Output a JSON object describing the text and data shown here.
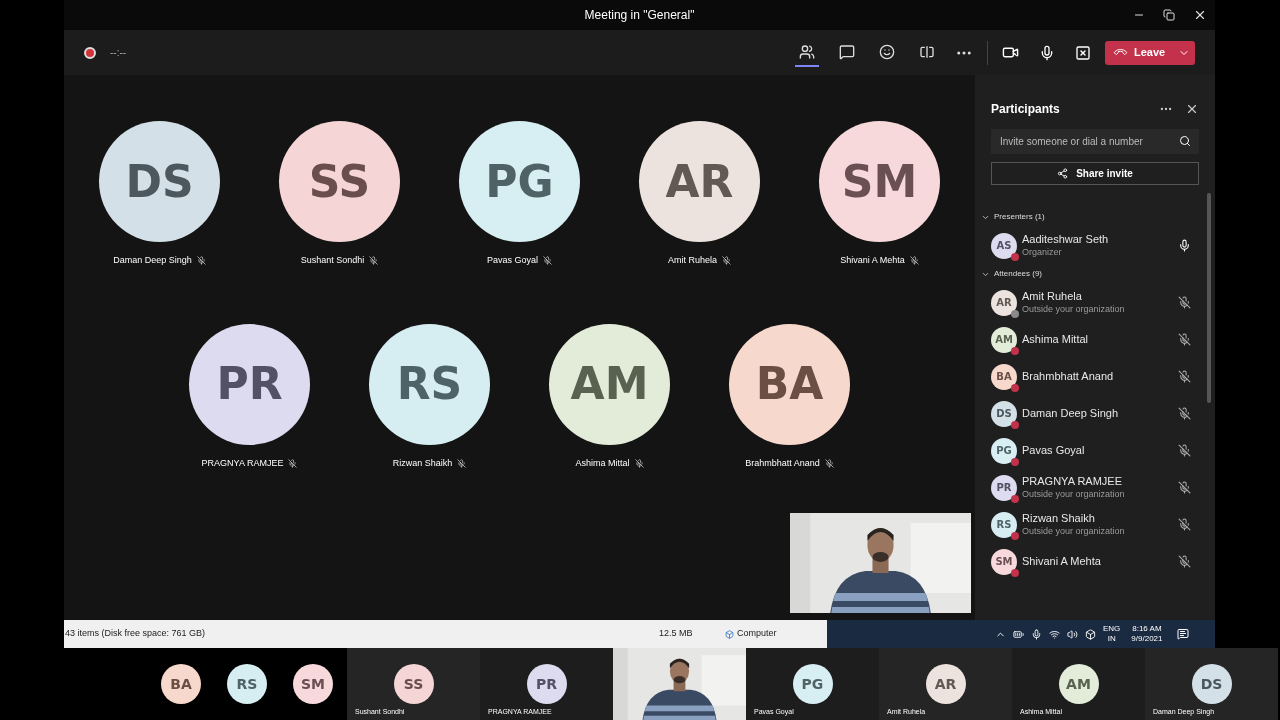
{
  "window": {
    "title": "Meeting in \"General\""
  },
  "toolbar": {
    "timer": "--:--",
    "leave": "Leave",
    "tabs": [
      {
        "kind": "people",
        "selected": true
      },
      {
        "kind": "chat",
        "selected": false
      },
      {
        "kind": "reactions",
        "selected": false
      },
      {
        "kind": "rooms",
        "selected": false
      }
    ]
  },
  "stage": {
    "rows": [
      [
        {
          "initials": "DS",
          "name": "Daman Deep Singh",
          "color": "#d4e0e8"
        },
        {
          "initials": "SS",
          "name": "Sushant Sondhi",
          "color": "#f5d5d5"
        },
        {
          "initials": "PG",
          "name": "Pavas Goyal",
          "color": "#d7eef2"
        },
        {
          "initials": "AR",
          "name": "Amit Ruhela",
          "color": "#ede3de"
        },
        {
          "initials": "SM",
          "name": "Shivani A Mehta",
          "color": "#f7d9dc"
        }
      ],
      [
        {
          "initials": "PR",
          "name": "PRAGNYA RAMJEE",
          "color": "#dcdbef"
        },
        {
          "initials": "RS",
          "name": "Rizwan Shaikh",
          "color": "#d6eef2"
        },
        {
          "initials": "AM",
          "name": "Ashima Mittal",
          "color": "#e3ecd9"
        },
        {
          "initials": "BA",
          "name": "Brahmbhatt Anand",
          "color": "#f7d8cc"
        }
      ]
    ]
  },
  "participants": {
    "title": "Participants",
    "search": {
      "placeholder": "Invite someone or dial a number"
    },
    "share": "Share invite",
    "sections": [
      {
        "label": "Presenters (1)",
        "expanded": true,
        "people": [
          {
            "initials": "AS",
            "name": "Aaditeshwar Seth",
            "subtitle": "Organizer",
            "color": "#dcdbef",
            "status": {
              "color": "#c4314b"
            },
            "muted": false
          }
        ]
      },
      {
        "label": "Attendees (9)",
        "expanded": true,
        "people": [
          {
            "initials": "AR",
            "name": "Amit Ruhela",
            "subtitle": "Outside your organization",
            "color": "#ede3de",
            "status": {
              "color": "#8a8a8a"
            },
            "muted": true
          },
          {
            "initials": "AM",
            "name": "Ashima Mittal",
            "color": "#e3ecd9",
            "status": {
              "color": "#c4314b"
            },
            "muted": true
          },
          {
            "initials": "BA",
            "name": "Brahmbhatt Anand",
            "color": "#f7d8cc",
            "status": {
              "color": "#c4314b"
            },
            "muted": true
          },
          {
            "initials": "DS",
            "name": "Daman Deep Singh",
            "color": "#d4e0e8",
            "status": {
              "color": "#c4314b"
            },
            "muted": true
          },
          {
            "initials": "PG",
            "name": "Pavas Goyal",
            "color": "#d7eef2",
            "status": {
              "color": "#c4314b"
            },
            "muted": true
          },
          {
            "initials": "PR",
            "name": "PRAGNYA RAMJEE",
            "subtitle": "Outside your organization",
            "color": "#dcdbef",
            "status": {
              "color": "#c4314b"
            },
            "muted": true
          },
          {
            "initials": "RS",
            "name": "Rizwan Shaikh",
            "subtitle": "Outside your organization",
            "color": "#d6eef2",
            "status": {
              "color": "#c4314b"
            },
            "muted": true
          },
          {
            "initials": "SM",
            "name": "Shivani A Mehta",
            "color": "#f7d9dc",
            "status": {
              "color": "#c4314b"
            },
            "muted": true
          }
        ]
      }
    ]
  },
  "explorer_status": {
    "items": "43 items (Disk free space: 761 GB)",
    "size": "12.5 MB",
    "location": "Computer"
  },
  "taskbar": {
    "language": "ENG",
    "region": "IN",
    "time": "8:16 AM",
    "date": "9/9/2021"
  },
  "filmstrip": {
    "overflow": [
      {
        "initials": "BA",
        "color": "#f7d8cc"
      },
      {
        "initials": "RS",
        "color": "#d6eef2"
      },
      {
        "initials": "SM",
        "color": "#f7d9dc"
      }
    ],
    "tiles": [
      {
        "kind": "avatar",
        "initials": "SS",
        "name": "Sushant Sondhi",
        "color": "#f5d5d5"
      },
      {
        "kind": "avatar",
        "initials": "PR",
        "name": "PRAGNYA RAMJEE",
        "color": "#dcdbef"
      },
      {
        "kind": "video"
      },
      {
        "kind": "avatar",
        "initials": "PG",
        "name": "Pavas Goyal",
        "color": "#d7eef2"
      },
      {
        "kind": "avatar",
        "initials": "AR",
        "name": "Amit Ruhela",
        "color": "#ede3de"
      },
      {
        "kind": "avatar",
        "initials": "AM",
        "name": "Ashima Mittal",
        "color": "#e3ecd9"
      },
      {
        "kind": "avatar",
        "initials": "DS",
        "name": "Daman Deep Singh",
        "color": "#d4e0e8"
      }
    ]
  }
}
